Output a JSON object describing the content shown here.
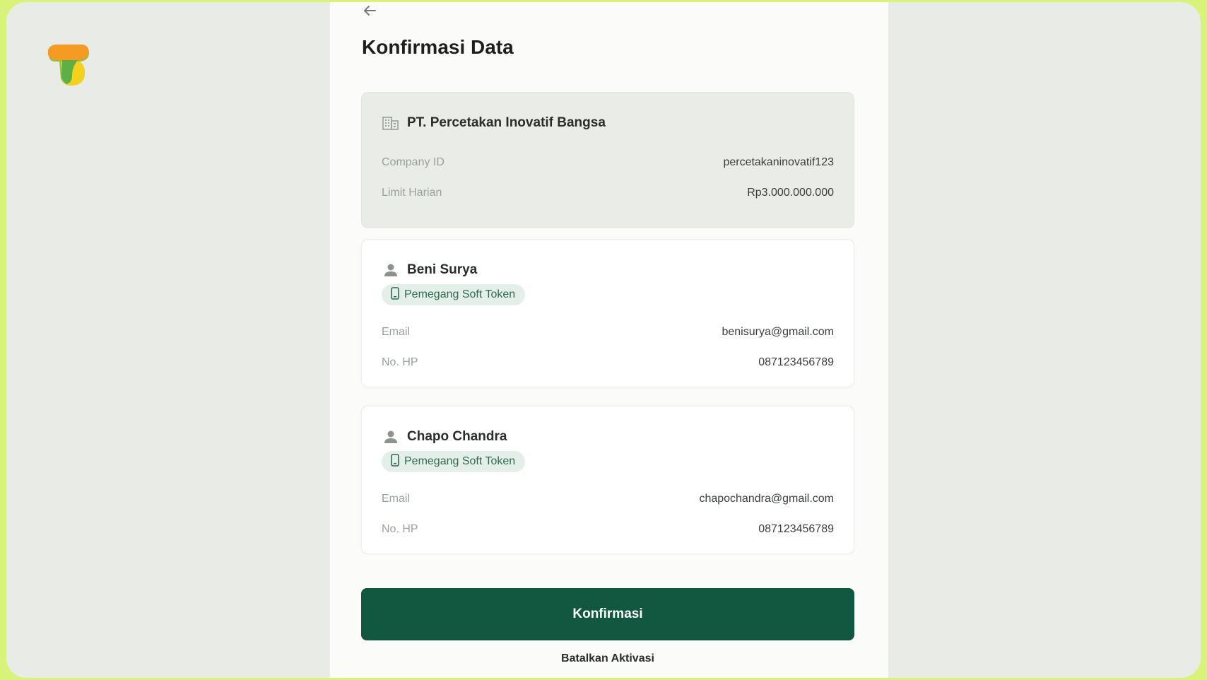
{
  "page": {
    "title": "Konfirmasi Data"
  },
  "company": {
    "icon": "building-icon",
    "name": "PT. Percetakan Inovatif Bangsa",
    "rows": [
      {
        "label": "Company ID",
        "value": "percetakaninovatif123"
      },
      {
        "label": "Limit Harian",
        "value": "Rp3.000.000.000"
      }
    ]
  },
  "users": [
    {
      "icon": "user-icon",
      "name": "Beni Surya",
      "badge": "Pemegang Soft Token",
      "badge_icon": "phone-icon",
      "rows": [
        {
          "label": "Email",
          "value": "benisurya@gmail.com"
        },
        {
          "label": "No. HP",
          "value": "087123456789"
        }
      ]
    },
    {
      "icon": "user-icon",
      "name": "Chapo Chandra",
      "badge": "Pemegang Soft Token",
      "badge_icon": "phone-icon",
      "rows": [
        {
          "label": "Email",
          "value": "chapochandra@gmail.com"
        },
        {
          "label": "No. HP",
          "value": "087123456789"
        }
      ]
    }
  ],
  "actions": {
    "confirm_label": "Konfirmasi",
    "cancel_label": "Batalkan Aktivasi"
  },
  "colors": {
    "primary": "#12573f",
    "outer_background": "#d9f27a",
    "badge_background": "#e3efe8"
  }
}
